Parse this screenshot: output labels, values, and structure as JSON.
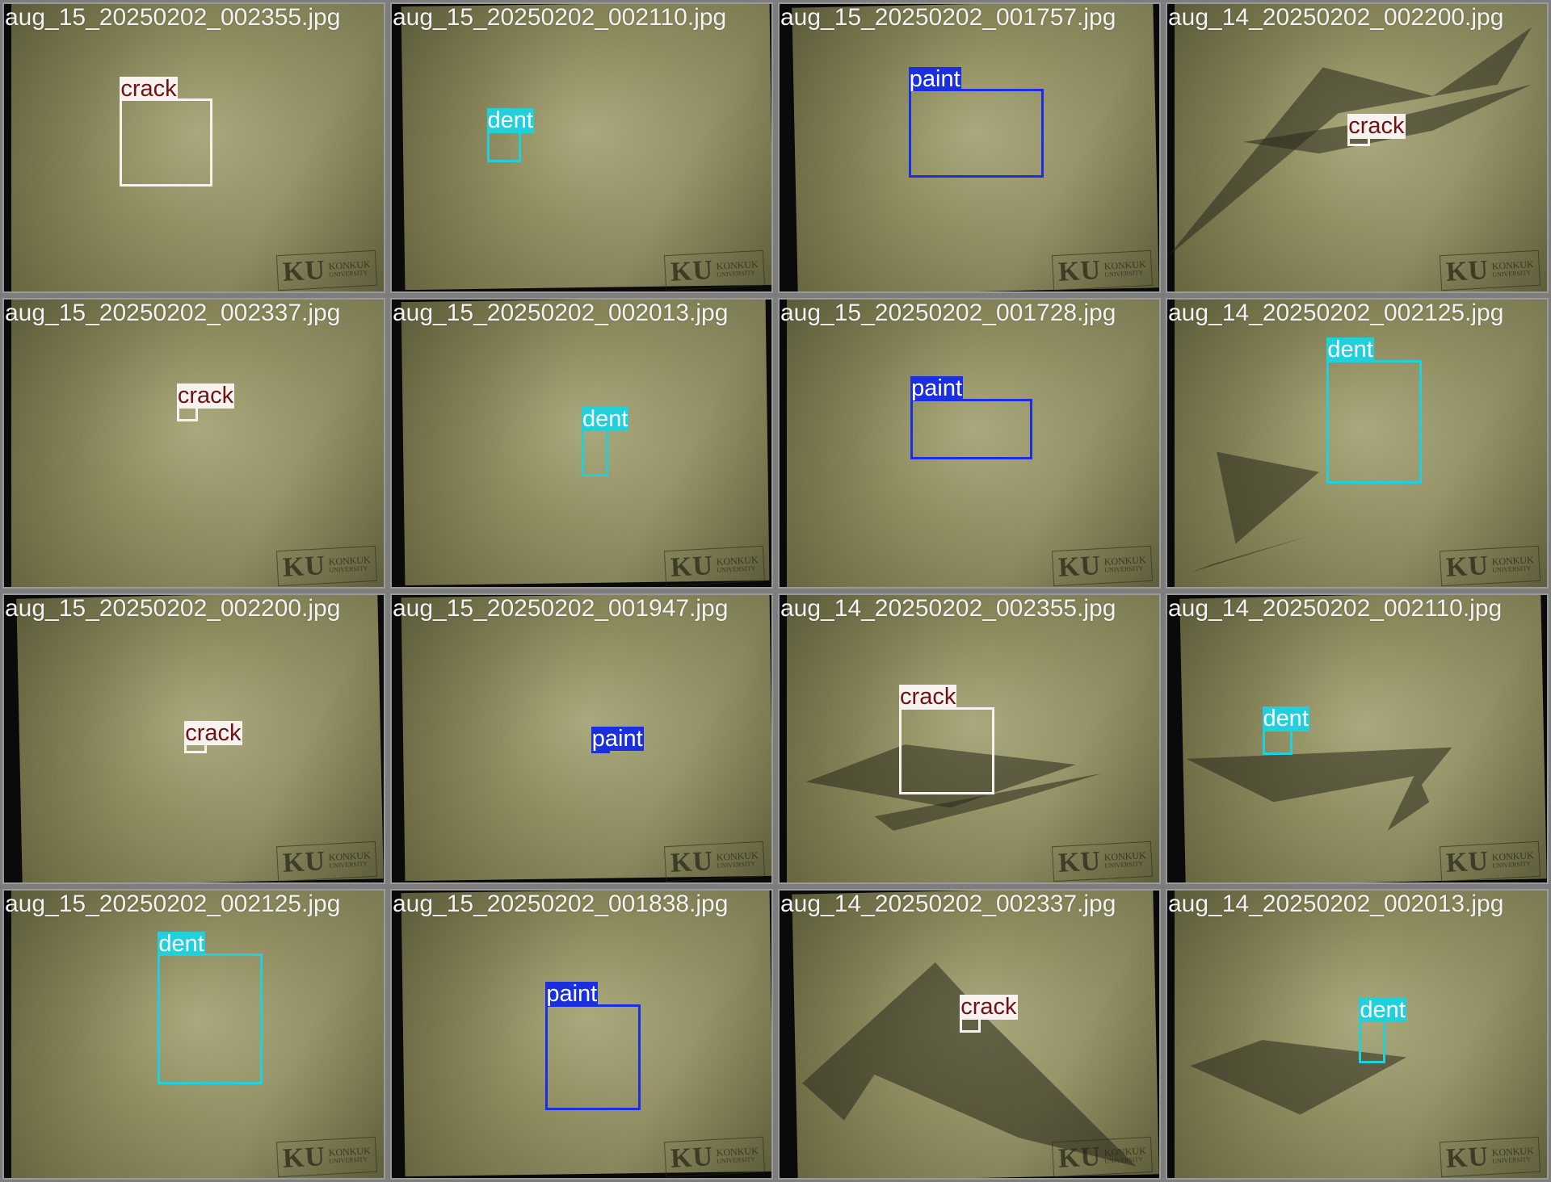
{
  "logo": {
    "initials": "KU",
    "line1": "KONKUK",
    "line2": "UNIVERSITY"
  },
  "class_colors": {
    "crack": {
      "box": "#f5f2f0",
      "text": "#6e1212"
    },
    "dent": {
      "box": "#22d0dc",
      "text": "#ffffff"
    },
    "paint": {
      "box": "#1a2fe0",
      "text": "#ffffff"
    }
  },
  "tiles": [
    {
      "filename": "aug_15_20250202_002355.jpg",
      "detections": [
        {
          "label": "crack"
        }
      ]
    },
    {
      "filename": "aug_15_20250202_002110.jpg",
      "detections": [
        {
          "label": "dent"
        }
      ]
    },
    {
      "filename": "aug_15_20250202_001757.jpg",
      "detections": [
        {
          "label": "paint"
        }
      ]
    },
    {
      "filename": "aug_14_20250202_002200.jpg",
      "detections": [
        {
          "label": "crack"
        }
      ]
    },
    {
      "filename": "aug_15_20250202_002337.jpg",
      "detections": [
        {
          "label": "crack"
        }
      ]
    },
    {
      "filename": "aug_15_20250202_002013.jpg",
      "detections": [
        {
          "label": "dent"
        }
      ]
    },
    {
      "filename": "aug_15_20250202_001728.jpg",
      "detections": [
        {
          "label": "paint"
        }
      ]
    },
    {
      "filename": "aug_14_20250202_002125.jpg",
      "detections": [
        {
          "label": "dent"
        }
      ]
    },
    {
      "filename": "aug_15_20250202_002200.jpg",
      "detections": [
        {
          "label": "crack"
        }
      ]
    },
    {
      "filename": "aug_15_20250202_001947.jpg",
      "detections": [
        {
          "label": "paint"
        }
      ]
    },
    {
      "filename": "aug_14_20250202_002355.jpg",
      "detections": [
        {
          "label": "crack"
        }
      ]
    },
    {
      "filename": "aug_14_20250202_002110.jpg",
      "detections": [
        {
          "label": "dent"
        }
      ]
    },
    {
      "filename": "aug_15_20250202_002125.jpg",
      "detections": [
        {
          "label": "dent"
        }
      ]
    },
    {
      "filename": "aug_15_20250202_001838.jpg",
      "detections": [
        {
          "label": "paint"
        }
      ]
    },
    {
      "filename": "aug_14_20250202_002337.jpg",
      "detections": [
        {
          "label": "crack"
        }
      ]
    },
    {
      "filename": "aug_14_20250202_002013.jpg",
      "detections": [
        {
          "label": "dent"
        }
      ]
    }
  ]
}
